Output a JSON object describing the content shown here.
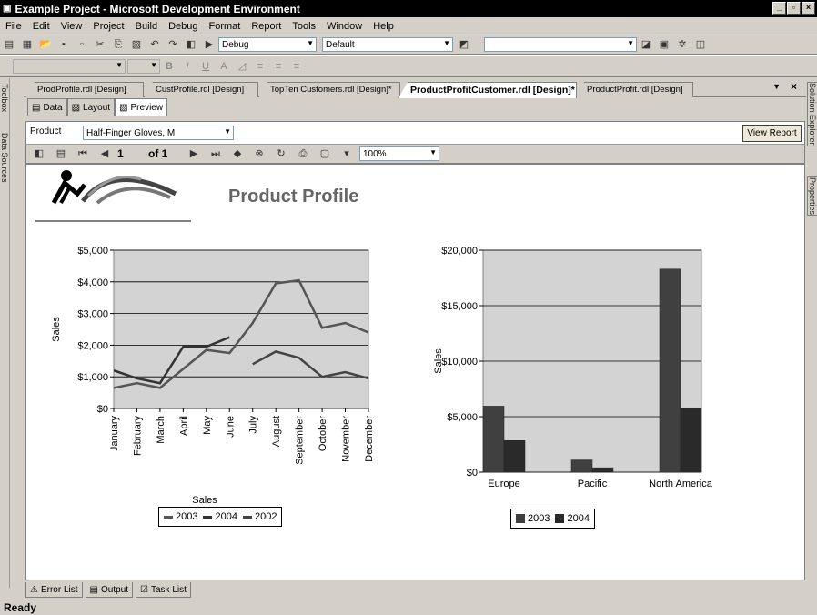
{
  "window": {
    "title": "Example Project - Microsoft Development Environment"
  },
  "menu": [
    "File",
    "Edit",
    "View",
    "Project",
    "Build",
    "Debug",
    "Format",
    "Report",
    "Tools",
    "Window",
    "Help"
  ],
  "toolbar": {
    "config": "Debug",
    "platform": "Default"
  },
  "side_left": [
    "Toolbox",
    "Data Sources"
  ],
  "side_right": [
    "Solution Explorer",
    "Properties"
  ],
  "doc_tabs": [
    "ProdProfile.rdl [Design]",
    "CustProfile.rdl [Design]",
    "TopTen Customers.rdl [Design]*",
    "ProductProfitCustomer.rdl [Design]*",
    "ProductProfit.rdl [Design]"
  ],
  "view_tabs": [
    "Data",
    "Layout",
    "Preview"
  ],
  "params": {
    "label": "Product",
    "value": "Half-Finger Gloves, M",
    "button": "View Report"
  },
  "report_toolbar": {
    "page": "1",
    "of": "of 1",
    "zoom": "100%"
  },
  "report": {
    "title": "Product Profile"
  },
  "chart_data": [
    {
      "type": "line",
      "xlabel": "Sales",
      "ylabel": "Sales",
      "ylim": [
        0,
        5000
      ],
      "yticks": [
        "$0",
        "$1,000",
        "$2,000",
        "$3,000",
        "$4,000",
        "$5,000"
      ],
      "categories": [
        "January",
        "February",
        "March",
        "April",
        "May",
        "June",
        "July",
        "August",
        "September",
        "October",
        "November",
        "December"
      ],
      "series": [
        {
          "name": "2003",
          "color": "#555555",
          "values": [
            650,
            800,
            650,
            1250,
            1850,
            1750,
            2700,
            3950,
            4050,
            2550,
            2700,
            2400
          ]
        },
        {
          "name": "2004",
          "color": "#333333",
          "values": [
            1200,
            950,
            800,
            1950,
            1950,
            2250,
            null,
            null,
            null,
            null,
            null,
            null
          ]
        },
        {
          "name": "2002",
          "color": "#444444",
          "values": [
            null,
            null,
            null,
            null,
            null,
            null,
            1400,
            1800,
            1600,
            1000,
            1150,
            950
          ]
        }
      ],
      "legend": "bottom",
      "grid": true
    },
    {
      "type": "bar",
      "xlabel": "",
      "ylabel": "Sales",
      "ylim": [
        0,
        20000
      ],
      "yticks": [
        "$0",
        "$5,000",
        "$10,000",
        "$15,000",
        "$20,000"
      ],
      "categories": [
        "Europe",
        "Pacific",
        "North America"
      ],
      "series": [
        {
          "name": "2003",
          "color": "#404040",
          "values": [
            5950,
            1100,
            18300
          ]
        },
        {
          "name": "2004",
          "color": "#2a2a2a",
          "values": [
            2850,
            400,
            5800
          ]
        }
      ],
      "legend": "bottom",
      "grid": true
    }
  ],
  "bottom_tabs": [
    "Error List",
    "Output",
    "Task List"
  ],
  "status": "Ready"
}
